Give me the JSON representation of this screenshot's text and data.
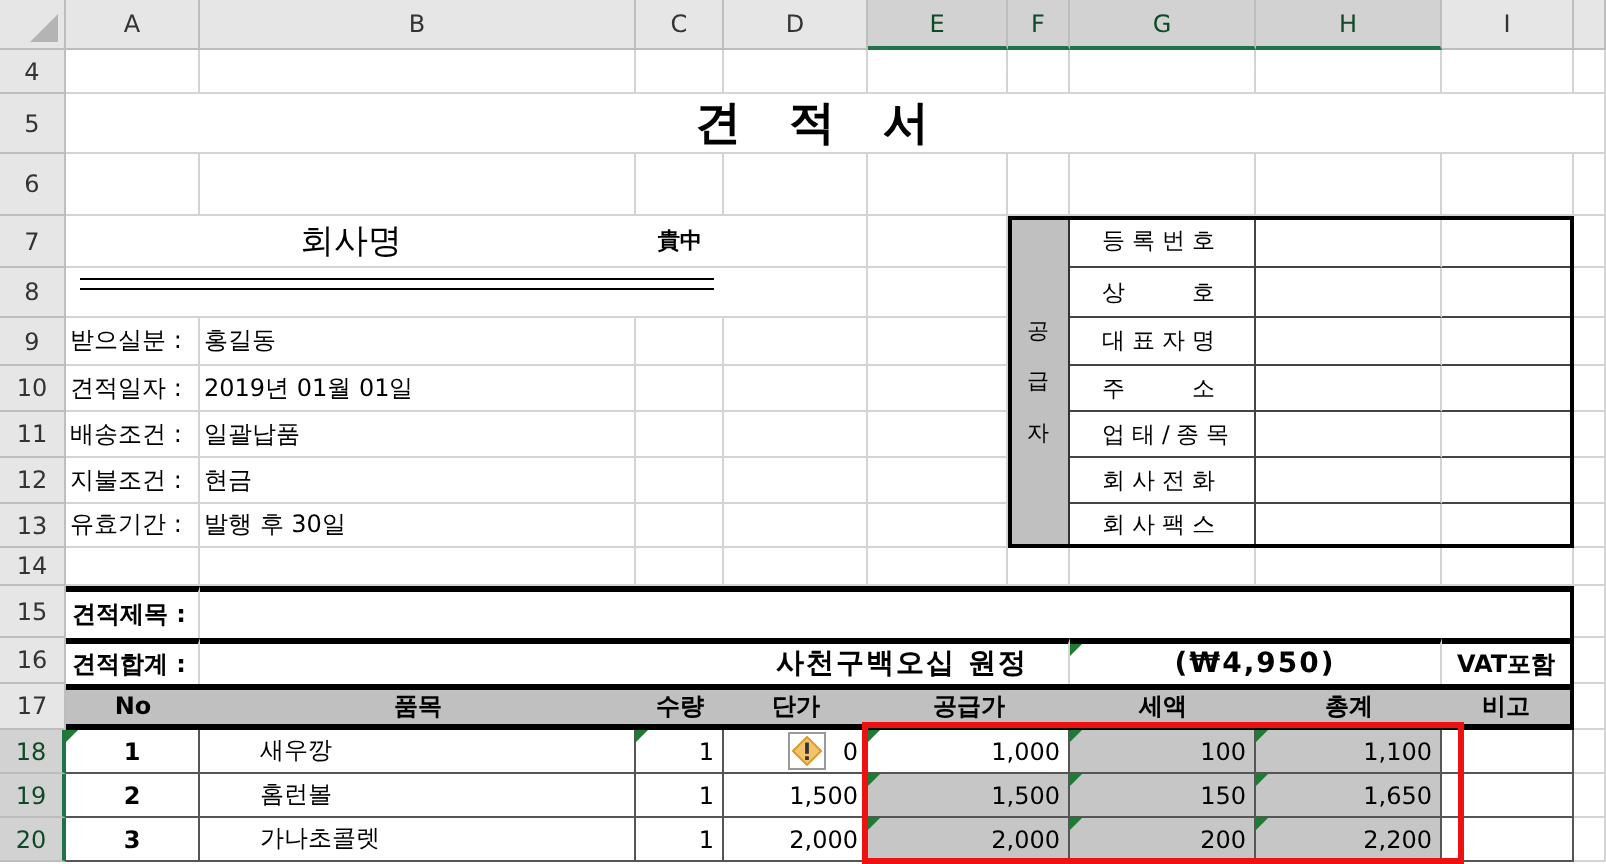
{
  "sheet": {
    "columns": [
      {
        "label": "A",
        "selected": false
      },
      {
        "label": "B",
        "selected": false
      },
      {
        "label": "C",
        "selected": false
      },
      {
        "label": "D",
        "selected": false
      },
      {
        "label": "E",
        "selected": true
      },
      {
        "label": "F",
        "selected": true
      },
      {
        "label": "G",
        "selected": true
      },
      {
        "label": "H",
        "selected": true
      },
      {
        "label": "I",
        "selected": false
      }
    ],
    "rows": [
      {
        "label": "4",
        "selected": false
      },
      {
        "label": "5",
        "selected": false
      },
      {
        "label": "6",
        "selected": false
      },
      {
        "label": "7",
        "selected": false
      },
      {
        "label": "8",
        "selected": false
      },
      {
        "label": "9",
        "selected": false
      },
      {
        "label": "10",
        "selected": false
      },
      {
        "label": "11",
        "selected": false
      },
      {
        "label": "12",
        "selected": false
      },
      {
        "label": "13",
        "selected": false
      },
      {
        "label": "14",
        "selected": false
      },
      {
        "label": "15",
        "selected": false
      },
      {
        "label": "16",
        "selected": false
      },
      {
        "label": "17",
        "selected": false
      },
      {
        "label": "18",
        "selected": true
      },
      {
        "label": "19",
        "selected": true
      },
      {
        "label": "20",
        "selected": true
      }
    ]
  },
  "title": "견 적 서",
  "recipient": {
    "company": "회사명",
    "honorific": "貴中"
  },
  "details": [
    {
      "label": "받으실분 :",
      "value": "홍길동"
    },
    {
      "label": "견적일자 :",
      "value": "2019년 01월 01일"
    },
    {
      "label": "배송조건 :",
      "value": "일괄납품"
    },
    {
      "label": "지불조건 :",
      "value": "현금"
    },
    {
      "label": "유효기간 :",
      "value": "발행 후 30일"
    }
  ],
  "supplier": {
    "label": "공급자",
    "fields": [
      "등록번호",
      "상 호",
      "대표자명",
      "주 소",
      "업태/종목",
      "회사전화",
      "회사팩스"
    ]
  },
  "subject": {
    "label": "견적제목 :"
  },
  "total": {
    "label": "견적합계 :",
    "in_words": "사천구백오십 원정",
    "in_words_flag": false,
    "amount": "(₩4,950)",
    "amount_flag": true,
    "note": "VAT포함"
  },
  "items": {
    "columns": [
      "No",
      "품목",
      "수량",
      "단가",
      "공급가",
      "세액",
      "총계",
      "비고"
    ],
    "rows": [
      {
        "cells": [
          {
            "text": "1",
            "flag": true,
            "selected": false,
            "warning": false
          },
          {
            "text": "새우깡",
            "flag": false,
            "selected": false,
            "warning": false
          },
          {
            "text": "1",
            "flag": true,
            "selected": false,
            "warning": false
          },
          {
            "text": "0",
            "flag": false,
            "selected": false,
            "warning": true
          },
          {
            "text": "1,000",
            "flag": true,
            "selected": false,
            "warning": false
          },
          {
            "text": "100",
            "flag": true,
            "selected": true,
            "warning": false
          },
          {
            "text": "1,100",
            "flag": true,
            "selected": true,
            "warning": false
          }
        ]
      },
      {
        "cells": [
          {
            "text": "2",
            "flag": false,
            "selected": false,
            "warning": false
          },
          {
            "text": "홈런볼",
            "flag": false,
            "selected": false,
            "warning": false
          },
          {
            "text": "1",
            "flag": false,
            "selected": false,
            "warning": false
          },
          {
            "text": "1,500",
            "flag": false,
            "selected": false,
            "warning": false
          },
          {
            "text": "1,500",
            "flag": true,
            "selected": true,
            "warning": false
          },
          {
            "text": "150",
            "flag": true,
            "selected": true,
            "warning": false
          },
          {
            "text": "1,650",
            "flag": true,
            "selected": true,
            "warning": false
          }
        ]
      },
      {
        "cells": [
          {
            "text": "3",
            "flag": false,
            "selected": false,
            "warning": false
          },
          {
            "text": "가나초콜렛",
            "flag": false,
            "selected": false,
            "warning": false
          },
          {
            "text": "1",
            "flag": false,
            "selected": false,
            "warning": false
          },
          {
            "text": "2,000",
            "flag": false,
            "selected": false,
            "warning": false
          },
          {
            "text": "2,000",
            "flag": true,
            "selected": true,
            "warning": false
          },
          {
            "text": "200",
            "flag": true,
            "selected": true,
            "warning": false
          },
          {
            "text": "2,200",
            "flag": true,
            "selected": true,
            "warning": false
          }
        ]
      }
    ]
  }
}
